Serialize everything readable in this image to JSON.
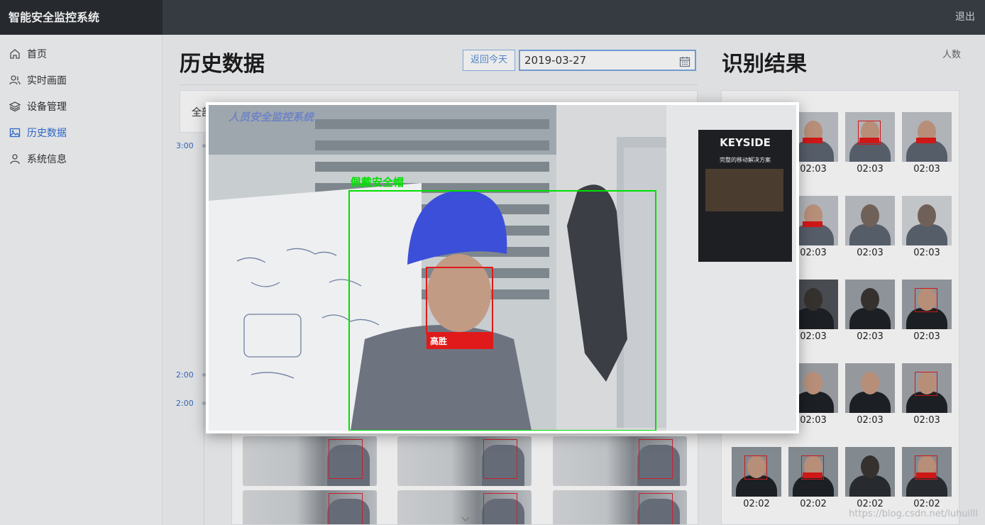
{
  "app": {
    "title": "智能安全监控系统",
    "logout_label": "退出"
  },
  "sidebar": {
    "items": [
      {
        "label": "首页",
        "icon": "home-icon",
        "active": false
      },
      {
        "label": "实时画面",
        "icon": "users-icon",
        "active": false
      },
      {
        "label": "设备管理",
        "icon": "layers-icon",
        "active": false
      },
      {
        "label": "历史数据",
        "icon": "image-icon",
        "active": true
      },
      {
        "label": "系统信息",
        "icon": "user-icon",
        "active": false
      }
    ]
  },
  "history": {
    "title": "历史数据",
    "today_button": "返回今天",
    "date_value": "2019-03-27",
    "filter_all": "全部",
    "timeline": [
      "3:00",
      "2:00",
      "2:00"
    ]
  },
  "results": {
    "title": "识别结果",
    "count_label": "人数",
    "times": [
      [
        "02:03",
        "02:03",
        "02:03"
      ],
      [
        "02:03",
        "02:03",
        "02:03"
      ],
      [
        "02:03",
        "02:03",
        "02:03"
      ],
      [
        "02:03",
        "02:03",
        "02:03"
      ],
      [
        "02:02",
        "02:02",
        "02:02",
        "02:02"
      ]
    ]
  },
  "modal": {
    "frame_caption": "人员安全监控系统",
    "helmet_label": "佩戴安全帽",
    "face_name": "高胜"
  },
  "poster": {
    "title": "KEYSIDE",
    "subtitle": "完整的移动解决方案"
  },
  "watermark": "https://blog.csdn.net/luhuilll",
  "colors": {
    "accent": "#2f6fd6",
    "topbar": "#3b4048",
    "helmet_box": "#00e000",
    "face_box": "#e01a1a"
  }
}
